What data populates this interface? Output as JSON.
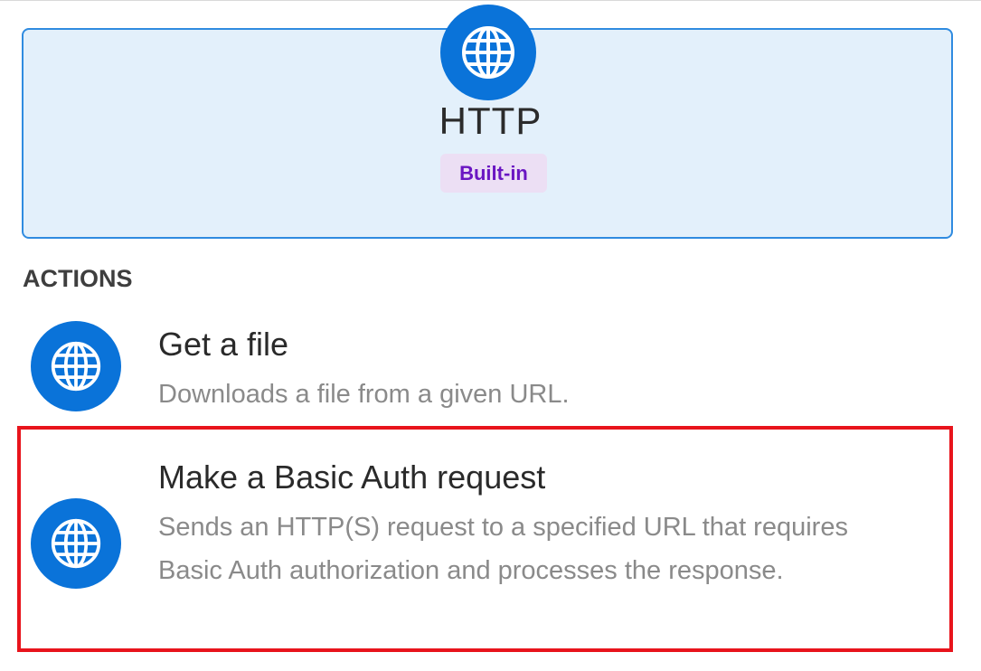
{
  "connector": {
    "icon": "globe-icon",
    "title": "HTTP",
    "badge": "Built-in",
    "accent": "#0a73d9",
    "card_background": "#e3f0fb",
    "badge_color": "#6a16c2"
  },
  "section": {
    "heading": "ACTIONS"
  },
  "actions": [
    {
      "icon": "globe-icon",
      "title": "Get a file",
      "description": "Downloads a file from a given URL."
    },
    {
      "icon": "globe-icon",
      "title": "Make a Basic Auth request",
      "description": "Sends an HTTP(S) request to a specified URL that requires Basic Auth authorization and processes the response.",
      "highlighted": true,
      "highlight_color": "#e8141c"
    }
  ]
}
